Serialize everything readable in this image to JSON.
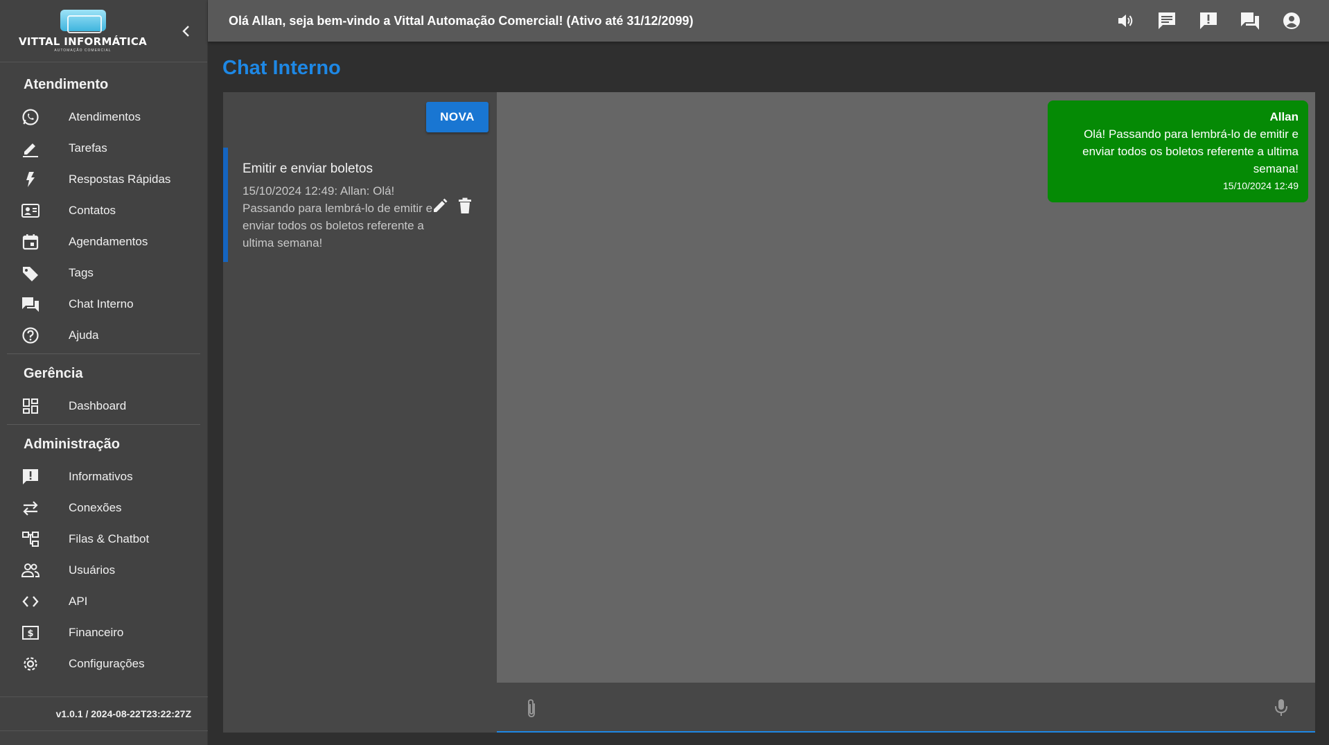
{
  "brand": {
    "name": "VITTAL INFORMÁTICA",
    "tagline": "AUTOMAÇÃO COMERCIAL"
  },
  "topbar": {
    "welcome": "Olá Allan, seja bem-vindo a Vittal Automação Comercial! (Ativo até 31/12/2099)",
    "icons": [
      "volume-icon",
      "message-icon",
      "announcement-icon",
      "forum-icon",
      "account-icon"
    ]
  },
  "sidebar": {
    "sections": [
      {
        "title": "Atendimento",
        "items": [
          {
            "label": "Atendimentos",
            "icon": "whatsapp-icon"
          },
          {
            "label": "Tarefas",
            "icon": "pencil-icon"
          },
          {
            "label": "Respostas Rápidas",
            "icon": "bolt-icon"
          },
          {
            "label": "Contatos",
            "icon": "contacts-icon"
          },
          {
            "label": "Agendamentos",
            "icon": "calendar-icon"
          },
          {
            "label": "Tags",
            "icon": "tag-icon"
          },
          {
            "label": "Chat Interno",
            "icon": "forum-icon"
          },
          {
            "label": "Ajuda",
            "icon": "help-icon"
          }
        ]
      },
      {
        "title": "Gerência",
        "items": [
          {
            "label": "Dashboard",
            "icon": "dashboard-icon"
          }
        ]
      },
      {
        "title": "Administração",
        "items": [
          {
            "label": "Informativos",
            "icon": "announcement-icon"
          },
          {
            "label": "Conexões",
            "icon": "sync-arrows-icon"
          },
          {
            "label": "Filas & Chatbot",
            "icon": "account-tree-icon"
          },
          {
            "label": "Usuários",
            "icon": "people-icon"
          },
          {
            "label": "API",
            "icon": "code-icon"
          },
          {
            "label": "Financeiro",
            "icon": "money-icon"
          },
          {
            "label": "Configurações",
            "icon": "gear-icon"
          }
        ]
      }
    ],
    "version": "v1.0.1 / 2024-08-22T23:22:27Z"
  },
  "page": {
    "title": "Chat Interno",
    "new_button": "NOVA"
  },
  "chats": [
    {
      "title": "Emitir e enviar boletos",
      "preview": "15/10/2024 12:49: Allan: Olá! Passando para lembrá-lo de emitir e enviar todos os boletos referente a ultima semana!"
    }
  ],
  "messages": [
    {
      "author": "Allan",
      "text": "Olá! Passando para lembrá-lo de emitir e enviar todos os boletos referente a ultima semana!",
      "time": "15/10/2024 12:49"
    }
  ],
  "colors": {
    "accent": "#1e88e5",
    "button": "#1976d2",
    "bubble": "#058a05",
    "sidebar": "#424242",
    "topbar": "#595959"
  }
}
